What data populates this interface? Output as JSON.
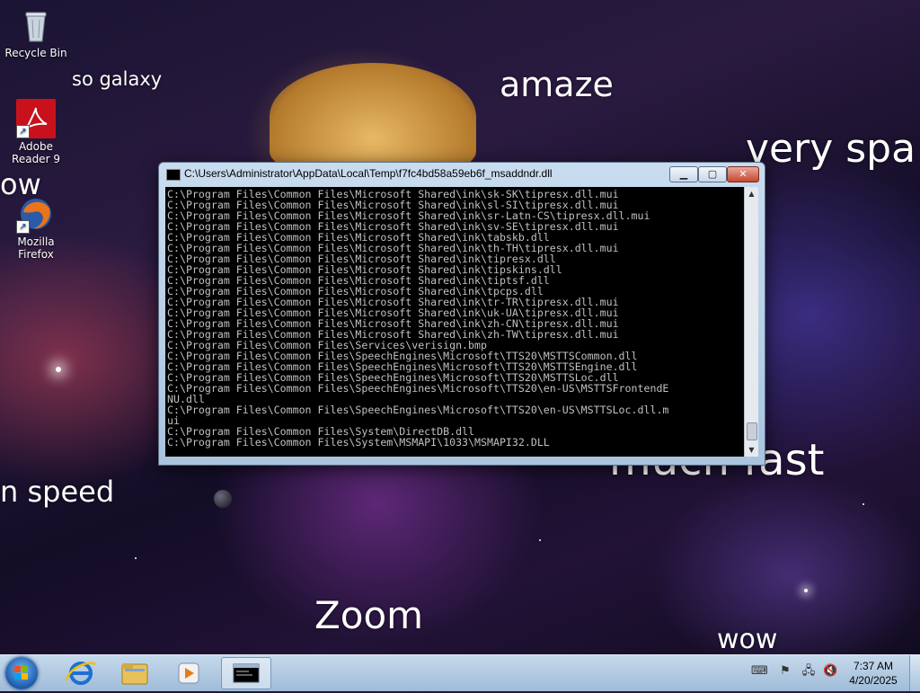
{
  "desktop": {
    "icons": [
      {
        "label": "Recycle Bin",
        "icon": "recycle-bin-icon"
      },
      {
        "label": "Adobe Reader 9",
        "icon": "adobe-reader-icon"
      },
      {
        "label": "Mozilla Firefox",
        "icon": "firefox-icon"
      }
    ],
    "wallpaper_words": {
      "so_galaxy": "so galaxy",
      "amaze": "amaze",
      "very_spa": "very spa",
      "wow_left": "ow",
      "much_fast": "much fast",
      "n_speed": "n speed",
      "zoom": "Zoom",
      "wow_bottom": "wow"
    }
  },
  "console_window": {
    "title": "C:\\Users\\Administrator\\AppData\\Local\\Temp\\f7fc4bd58a59eb6f_msaddndr.dll",
    "buttons": {
      "minimize": "▁",
      "maximize": "▢",
      "close": "✕"
    },
    "lines": [
      "C:\\Program Files\\Common Files\\Microsoft Shared\\ink\\sk-SK\\tipresx.dll.mui",
      "C:\\Program Files\\Common Files\\Microsoft Shared\\ink\\sl-SI\\tipresx.dll.mui",
      "C:\\Program Files\\Common Files\\Microsoft Shared\\ink\\sr-Latn-CS\\tipresx.dll.mui",
      "C:\\Program Files\\Common Files\\Microsoft Shared\\ink\\sv-SE\\tipresx.dll.mui",
      "C:\\Program Files\\Common Files\\Microsoft Shared\\ink\\tabskb.dll",
      "C:\\Program Files\\Common Files\\Microsoft Shared\\ink\\th-TH\\tipresx.dll.mui",
      "C:\\Program Files\\Common Files\\Microsoft Shared\\ink\\tipresx.dll",
      "C:\\Program Files\\Common Files\\Microsoft Shared\\ink\\tipskins.dll",
      "C:\\Program Files\\Common Files\\Microsoft Shared\\ink\\tiptsf.dll",
      "C:\\Program Files\\Common Files\\Microsoft Shared\\ink\\tpcps.dll",
      "C:\\Program Files\\Common Files\\Microsoft Shared\\ink\\tr-TR\\tipresx.dll.mui",
      "C:\\Program Files\\Common Files\\Microsoft Shared\\ink\\uk-UA\\tipresx.dll.mui",
      "C:\\Program Files\\Common Files\\Microsoft Shared\\ink\\zh-CN\\tipresx.dll.mui",
      "C:\\Program Files\\Common Files\\Microsoft Shared\\ink\\zh-TW\\tipresx.dll.mui",
      "C:\\Program Files\\Common Files\\Services\\verisign.bmp",
      "C:\\Program Files\\Common Files\\SpeechEngines\\Microsoft\\TTS20\\MSTTSCommon.dll",
      "C:\\Program Files\\Common Files\\SpeechEngines\\Microsoft\\TTS20\\MSTTSEngine.dll",
      "C:\\Program Files\\Common Files\\SpeechEngines\\Microsoft\\TTS20\\MSTTSLoc.dll",
      "C:\\Program Files\\Common Files\\SpeechEngines\\Microsoft\\TTS20\\en-US\\MSTTSFrontendE",
      "NU.dll",
      "C:\\Program Files\\Common Files\\SpeechEngines\\Microsoft\\TTS20\\en-US\\MSTTSLoc.dll.m",
      "ui",
      "C:\\Program Files\\Common Files\\System\\DirectDB.dll",
      "C:\\Program Files\\Common Files\\System\\MSMAPI\\1033\\MSMAPI32.DLL"
    ]
  },
  "taskbar": {
    "items": [
      {
        "icon": "internet-explorer-icon"
      },
      {
        "icon": "file-explorer-icon"
      },
      {
        "icon": "media-player-icon"
      },
      {
        "icon": "console-window-icon",
        "active": true
      }
    ],
    "tray": [
      "keyboard-icon",
      "action-center-flag-icon",
      "network-icon",
      "volume-muted-icon"
    ],
    "clock": {
      "time": "7:37 AM",
      "date": "4/20/2025"
    }
  },
  "colors": {
    "console_bg": "#000000",
    "console_text": "#c0c0c0",
    "taskbar": "#b3cbe3",
    "close_button": "#c7462f"
  }
}
